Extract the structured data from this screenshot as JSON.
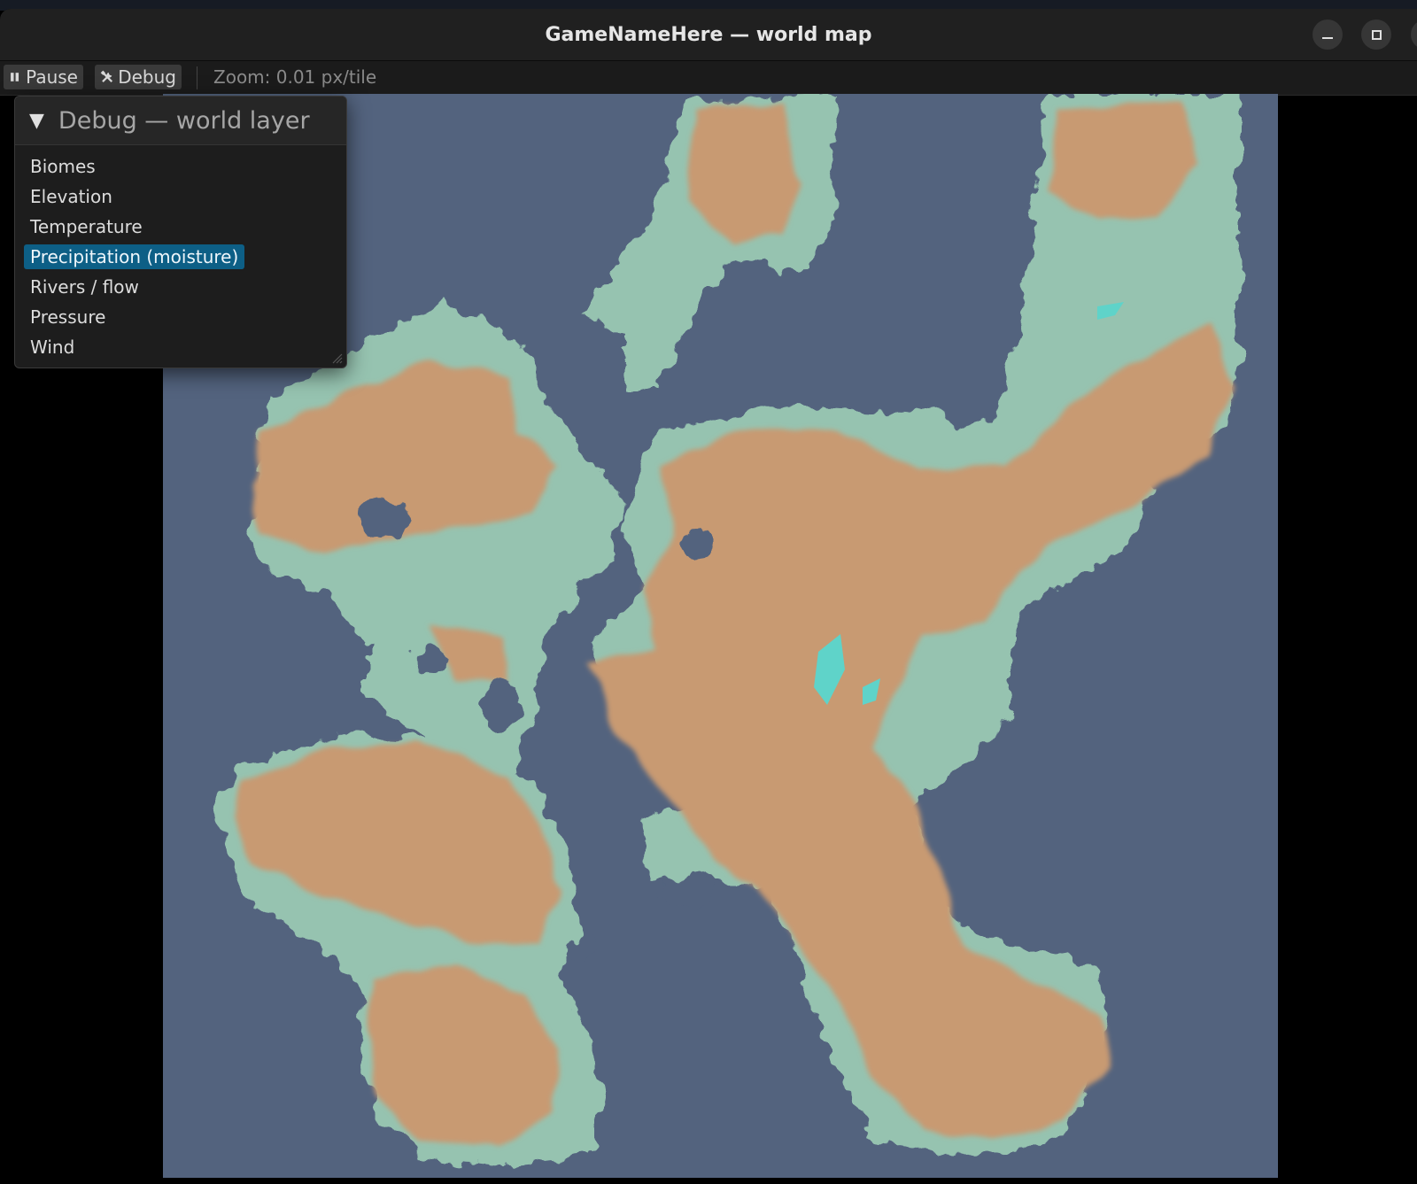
{
  "window": {
    "title": "GameNameHere — world map"
  },
  "toolbar": {
    "pause_label": "Pause",
    "debug_label": "Debug",
    "zoom_text": "Zoom: 0.01 px/tile"
  },
  "debug_panel": {
    "title": "Debug — world layer",
    "items": [
      {
        "label": "Biomes",
        "selected": false
      },
      {
        "label": "Elevation",
        "selected": false
      },
      {
        "label": "Temperature",
        "selected": false
      },
      {
        "label": "Precipitation (moisture)",
        "selected": true
      },
      {
        "label": "Rivers / flow",
        "selected": false
      },
      {
        "label": "Pressure",
        "selected": false
      },
      {
        "label": "Wind",
        "selected": false
      }
    ]
  },
  "map": {
    "layer": "Precipitation (moisture)",
    "colors": {
      "ocean": "#53637e",
      "dry": "#c89a72",
      "moist": "#96c3b0",
      "wet": "#5fd3c9"
    }
  },
  "colors": {
    "accent": "#0d5f86",
    "titlebar": "#202020",
    "panel": "#1d1d1d"
  }
}
